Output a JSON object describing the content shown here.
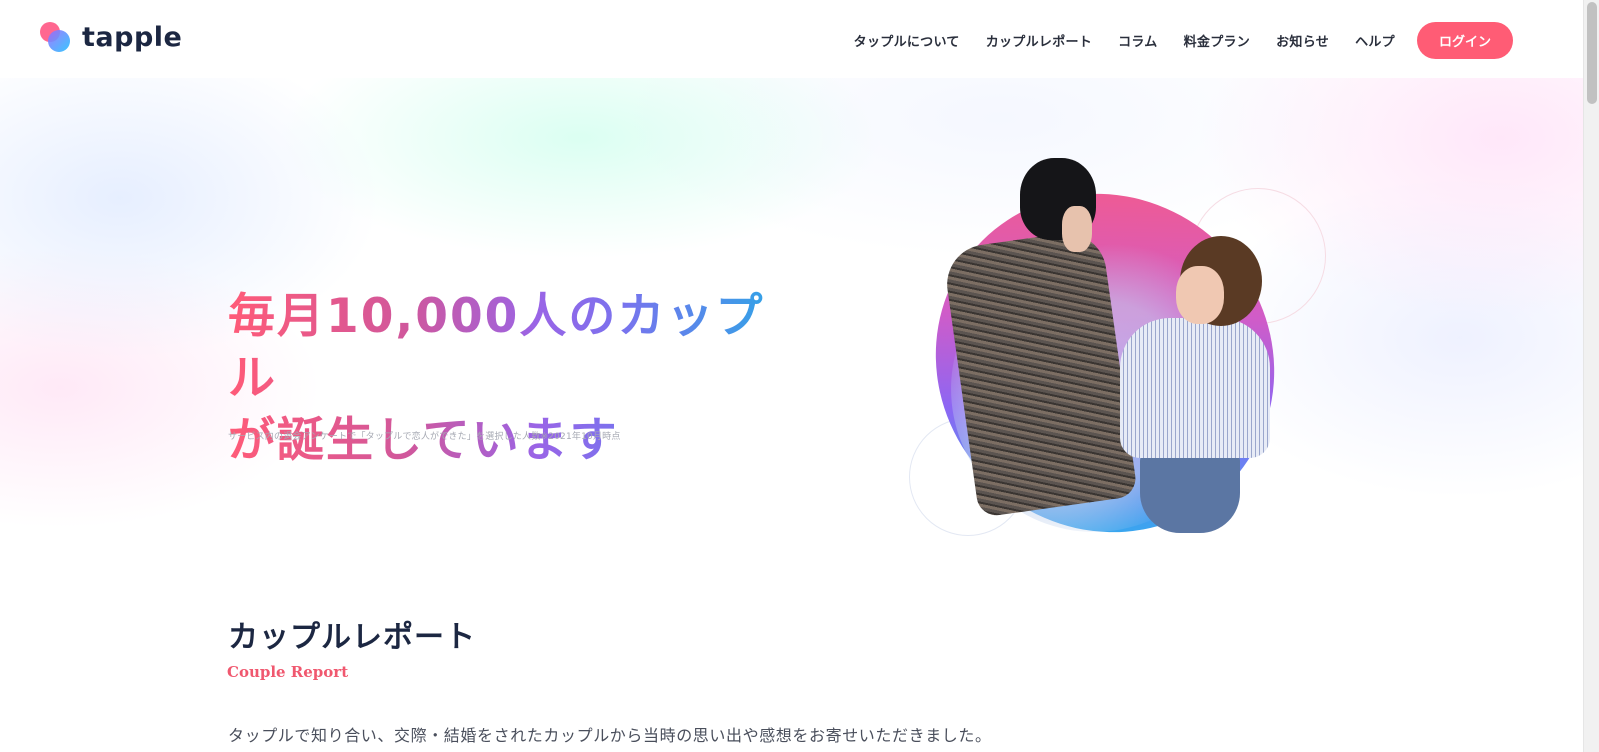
{
  "header": {
    "logo_text": "tapple",
    "nav": [
      {
        "label": "タップルについて"
      },
      {
        "label": "カップルレポート"
      },
      {
        "label": "コラム"
      },
      {
        "label": "料金プラン"
      },
      {
        "label": "お知らせ"
      },
      {
        "label": "ヘルプ"
      }
    ],
    "login_label": "ログイン"
  },
  "hero": {
    "title_line1": "毎月10,000人のカップル",
    "title_line2": "が誕生しています",
    "note": "サービス内の退会アンケートで「タップルで恋人ができた」を選択した人数※2021年10月時点"
  },
  "section": {
    "title": "カップルレポート",
    "subtitle": "Couple Report",
    "description": "タップルで知り合い、交際・結婚をされたカップルから当時の思い出や感想をお寄せいただきました。"
  },
  "colors": {
    "brand_pink": "#ff5c75",
    "subtitle_pink": "#f0586f",
    "gradient_start": "#ff5b78",
    "gradient_end": "#2aa8e6"
  },
  "icons": {
    "logo": "tapple-logo-icon"
  }
}
